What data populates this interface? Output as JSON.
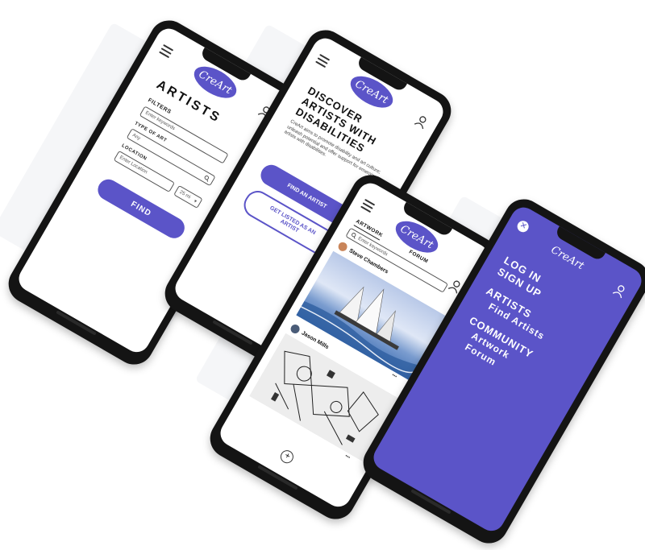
{
  "brand": {
    "logo_text": "CreArt",
    "accent": "#5b54c8"
  },
  "artists_screen": {
    "title": "ARTISTS",
    "filters_label": "FILTERS",
    "keywords_placeholder": "Enter keywords",
    "type_label": "TYPE OF ART",
    "type_value": "Any",
    "location_label": "LOCATION",
    "location_placeholder": "Enter Location",
    "distance_value": "25 mi",
    "find_label": "FIND"
  },
  "home_screen": {
    "title_line1": "DISCOVER",
    "title_line2": "ARTISTS WITH",
    "title_line3": "DISABILITIES",
    "description": "CreArt aims to promote disability and art culture; unleash potential and offer support for emerging artists with disabilities.",
    "find_artist_label": "FIND AN ARTIST",
    "get_listed_label": "GET LISTED AS AN ARTIST"
  },
  "community_screen": {
    "tab_artwork": "ARTWORK",
    "tab_forum": "FORUM",
    "search_placeholder": "Enter keywords",
    "post1_author": "Steve Chambers",
    "post2_author": "Jason Mills",
    "more_glyph": "•••",
    "add_glyph": "+"
  },
  "menu_screen": {
    "close_glyph": "✕",
    "items": [
      "LOG IN",
      "SIGN UP",
      "ARTISTS",
      "Find Artists",
      "COMMUNITY",
      "Artwork",
      "Forum"
    ]
  }
}
